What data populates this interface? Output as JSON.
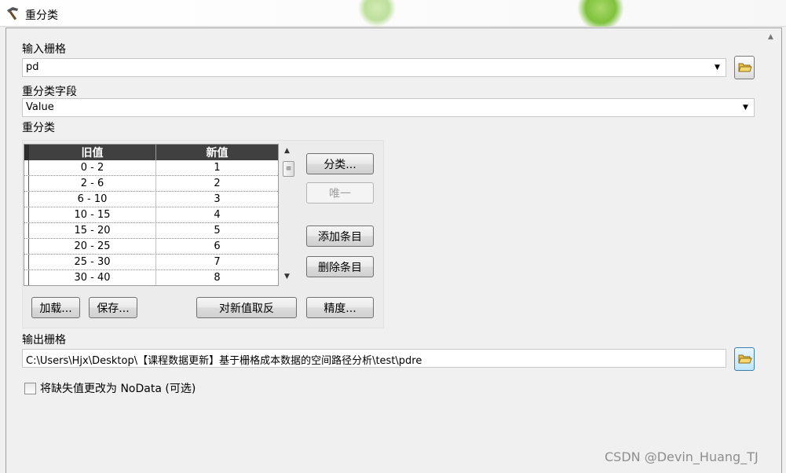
{
  "window": {
    "title": "重分类"
  },
  "input_raster": {
    "label": "输入栅格",
    "value": "pd"
  },
  "reclass_field": {
    "label": "重分类字段",
    "value": "Value"
  },
  "reclassification": {
    "label": "重分类",
    "columns": [
      "旧值",
      "新值"
    ],
    "rows": [
      [
        "0 - 2",
        "1"
      ],
      [
        "2 - 6",
        "2"
      ],
      [
        "6 - 10",
        "3"
      ],
      [
        "10 - 15",
        "4"
      ],
      [
        "15 - 20",
        "5"
      ],
      [
        "20 - 25",
        "6"
      ],
      [
        "25 - 30",
        "7"
      ],
      [
        "30 - 40",
        "8"
      ]
    ],
    "buttons": {
      "classify": "分类...",
      "unique": "唯一",
      "add_entry": "添加条目",
      "delete_entry": "删除条目",
      "load": "加载...",
      "save": "保存...",
      "reverse": "对新值取反",
      "precision": "精度..."
    }
  },
  "output_raster": {
    "label": "输出栅格",
    "value": "C:\\Users\\Hjx\\Desktop\\【课程数据更新】基于栅格成本数据的空间路径分析\\test\\pdre"
  },
  "nodata_option": {
    "label": "将缺失值更改为 NoData (可选)",
    "checked": false
  },
  "watermark": "CSDN @Devin_Huang_TJ",
  "icons": [
    "hammer-icon",
    "folder-open-icon",
    "chevron-down-icon",
    "scroll-up-icon",
    "scroll-down-icon"
  ]
}
